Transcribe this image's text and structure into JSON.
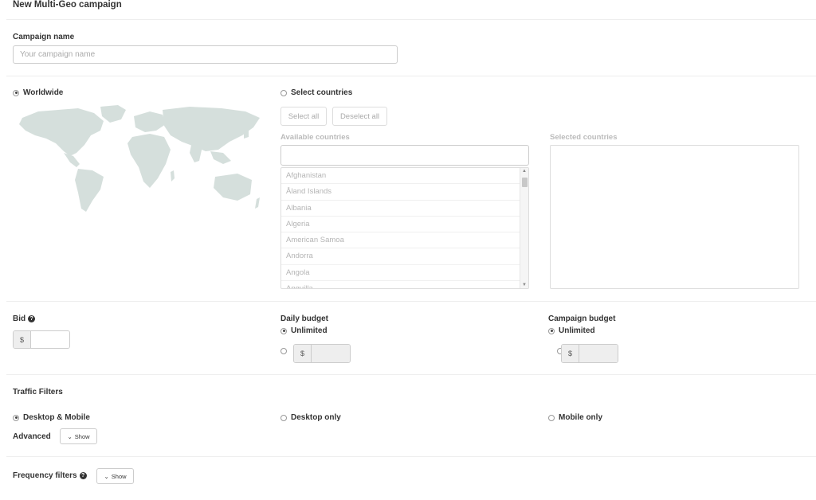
{
  "page": {
    "title": "New Multi-Geo campaign"
  },
  "campaign_name": {
    "label": "Campaign name",
    "placeholder": "Your campaign name"
  },
  "geo": {
    "worldwide_label": "Worldwide",
    "select_countries_label": "Select countries",
    "select_all_label": "Select all",
    "deselect_all_label": "Deselect all",
    "available_label": "Available countries",
    "selected_label": "Selected countries",
    "available_countries": [
      "Afghanistan",
      "Åland Islands",
      "Albania",
      "Algeria",
      "American Samoa",
      "Andorra",
      "Angola",
      "Anguilla"
    ]
  },
  "bid": {
    "label": "Bid",
    "currency": "$",
    "help_icon": "question-circle-icon"
  },
  "daily_budget": {
    "label": "Daily budget",
    "unlimited_label": "Unlimited",
    "currency": "$"
  },
  "campaign_budget": {
    "label": "Campaign budget",
    "unlimited_label": "Unlimited",
    "currency": "$"
  },
  "traffic_filters": {
    "label": "Traffic Filters",
    "options": [
      "Desktop & Mobile",
      "Desktop only",
      "Mobile only"
    ],
    "advanced_label": "Advanced",
    "show_label": "Show"
  },
  "frequency_filters": {
    "label": "Frequency filters",
    "show_label": "Show",
    "help_icon": "question-circle-icon"
  },
  "colors": {
    "map_fill": "#d5dfdc",
    "border": "#cccccc",
    "muted_text": "#b5b5b5"
  }
}
